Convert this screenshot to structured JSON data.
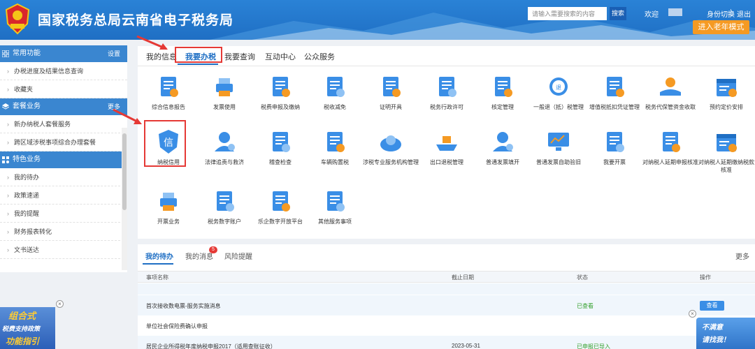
{
  "header": {
    "site_title": "国家税务总局云南省电子税务局",
    "search_placeholder": "请输入需要搜索的内容",
    "search_button": "搜索",
    "welcome": "欢迎",
    "switch_identity": "身份切换",
    "logout": "退出",
    "elder_mode": "进入老年模式"
  },
  "sidebar": {
    "sections": [
      {
        "title": "常用功能",
        "more": "设置",
        "icon": "grid-icon",
        "items": [
          "办税进度及结果信息查询",
          "收藏夹"
        ]
      },
      {
        "title": "套餐业务",
        "more": "更多",
        "icon": "layers-icon",
        "items": [
          "新办纳税人套餐服务",
          "跨区域涉税事项综合办理套餐"
        ]
      },
      {
        "title": "特色业务",
        "more": "",
        "icon": "apps-icon",
        "items": [
          "我的待办",
          "政策速递",
          "我的提醒",
          "财务报表转化",
          "文书送达"
        ]
      }
    ]
  },
  "main": {
    "tabs": [
      "我的信息",
      "我要办税",
      "我要查询",
      "互动中心",
      "公众服务"
    ],
    "active_tab": "我要办税",
    "services": [
      {
        "label": "综合信息报告",
        "icon": "report-icon"
      },
      {
        "label": "发票使用",
        "icon": "printer-icon"
      },
      {
        "label": "税费申报及缴纳",
        "icon": "declare-icon"
      },
      {
        "label": "税收减免",
        "icon": "tax-reduction-icon"
      },
      {
        "label": "证明开具",
        "icon": "certificate-icon"
      },
      {
        "label": "税务行政许可",
        "icon": "license-icon"
      },
      {
        "label": "核定管理",
        "icon": "approval-icon"
      },
      {
        "label": "一般退（抵）税管理",
        "icon": "refund-icon"
      },
      {
        "label": "增值税抵扣凭证管理",
        "icon": "voucher-icon"
      },
      {
        "label": "税务代保管资金收取",
        "icon": "custody-icon"
      },
      {
        "label": "预约定价安排",
        "icon": "calendar-icon"
      },
      {
        "label": "纳税信用",
        "icon": "credit-icon"
      },
      {
        "label": "法律追责与救济",
        "icon": "legal-icon"
      },
      {
        "label": "稽查检查",
        "icon": "inspection-icon"
      },
      {
        "label": "车辆购置税",
        "icon": "vehicle-tax-icon"
      },
      {
        "label": "涉税专业服务机构管理",
        "icon": "agency-icon"
      },
      {
        "label": "出口退税管理",
        "icon": "export-ship-icon"
      },
      {
        "label": "普通发票填开",
        "icon": "invoice-user-icon"
      },
      {
        "label": "普通发票自助验旧",
        "icon": "monitor-chart-icon"
      },
      {
        "label": "我要开票",
        "icon": "issue-invoice-icon"
      },
      {
        "label": "对纳税人延期申报核准",
        "icon": "extension-icon"
      },
      {
        "label": "对纳税人延期缴纳税款核准",
        "icon": "calendar-icon"
      },
      {
        "label": "开票业务",
        "icon": "printer-icon"
      },
      {
        "label": "税务数字账户",
        "icon": "digital-account-icon"
      },
      {
        "label": "乐企数字开放平台",
        "icon": "platform-icon"
      },
      {
        "label": "其他服务事项",
        "icon": "other-icon"
      }
    ]
  },
  "todo": {
    "tabs": [
      "我的待办",
      "我的消息",
      "风险提醒"
    ],
    "message_count": "5",
    "more": "更多",
    "columns": [
      "事项名称",
      "截止日期",
      "状态",
      "操作"
    ],
    "rows": [
      {
        "name": "首次接收数电票-服务实施消息",
        "date": "",
        "status": "已查看",
        "action": "查看"
      },
      {
        "name": "单位社会保险费确认申报",
        "date": "",
        "status": "",
        "action": ""
      },
      {
        "name": "居民企业所得税年度纳税申报2017（适用查账征收）",
        "date": "2023-05-31",
        "status": "已申报已导入",
        "action": ""
      }
    ]
  },
  "ads": {
    "left": [
      "组合式",
      "税费支持政策",
      "功能指引"
    ],
    "right": [
      "不满意",
      "请找我！"
    ]
  }
}
